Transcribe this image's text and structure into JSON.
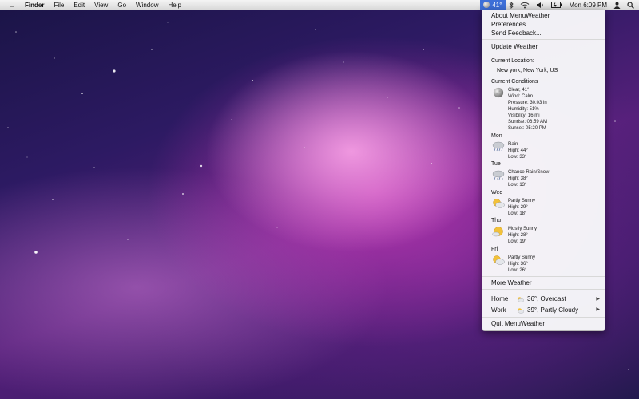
{
  "menubar": {
    "app_name": "Finder",
    "menus": [
      "File",
      "Edit",
      "View",
      "Go",
      "Window",
      "Help"
    ],
    "weather_temp": "41°",
    "clock": "Mon 6:09 PM"
  },
  "menu": {
    "about": "About MenuWeather",
    "preferences": "Preferences...",
    "feedback": "Send Feedback...",
    "update": "Update Weather",
    "current_location_label": "Current Location:",
    "current_location": "New york, New York, US",
    "current_conditions_label": "Current Conditions",
    "current": [
      "Clear, 41°",
      "Wind: Calm",
      "Pressure: 30.03 in",
      "Humidity: 51%",
      "Visibility: 16 mi",
      "Sunrise: 06:59 AM",
      "Sunset: 05:20 PM"
    ],
    "forecast": [
      {
        "day": "Mon",
        "cond": "Rain",
        "high": "High: 44°",
        "low": "Low: 33°",
        "icon": "rain-cloud-icon"
      },
      {
        "day": "Tue",
        "cond": "Chance Rain/Snow",
        "high": "High: 38°",
        "low": "Low: 13°",
        "icon": "rain-snow-cloud-icon"
      },
      {
        "day": "Wed",
        "cond": "Partly Sunny",
        "high": "High: 29°",
        "low": "Low: 18°",
        "icon": "partly-sunny-icon"
      },
      {
        "day": "Thu",
        "cond": "Mostly Sunny",
        "high": "High: 28°",
        "low": "Low: 19°",
        "icon": "mostly-sunny-icon"
      },
      {
        "day": "Fri",
        "cond": "Partly Sunny",
        "high": "High: 36°",
        "low": "Low: 26°",
        "icon": "partly-sunny-icon"
      }
    ],
    "more": "More Weather",
    "locations": [
      {
        "name": "Home",
        "summary": "36°, Overcast"
      },
      {
        "name": "Work",
        "summary": "39°, Partly Cloudy"
      }
    ],
    "quit": "Quit MenuWeather"
  }
}
